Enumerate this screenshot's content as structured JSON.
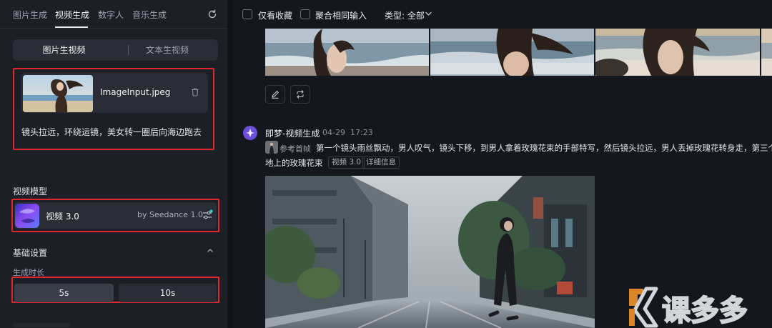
{
  "left": {
    "tabs": [
      "图片生成",
      "视频生成",
      "数字人",
      "音乐生成"
    ],
    "active_tab": "视频生成",
    "mode_tabs": [
      "图片生视频",
      "文本生视频"
    ],
    "active_mode": "图片生视频",
    "image_input": {
      "filename": "ImageInput.jpeg",
      "prompt": "镜头拉远，环绕运镜，美女转一圈后向海边跑去"
    },
    "model_section_title": "视频模型",
    "model": {
      "name": "视频 3.0",
      "provider": "by Seedance 1.0"
    },
    "basic_settings_title": "基础设置",
    "duration_title": "生成时长",
    "durations": [
      "5s",
      "10s"
    ],
    "selected_duration": "5s"
  },
  "right": {
    "filters": {
      "only_favorites": "仅看收藏",
      "aggregate_same_input": "聚合相同输入",
      "type_label": "类型: 全部"
    },
    "message": {
      "title": "即梦-视频生成",
      "date": "04-29",
      "time": "17:23",
      "ref_label": "参考首帧",
      "desc_line1": "第一个镜头雨丝飘动，男人叹气，镜头下移，到男人拿着玫瑰花束的手部特写，然后镜头拉远，男人丢掉玫瑰花转身走，第三个",
      "desc_line2": "地上的玫瑰花束",
      "tag_model": "视频 3.0",
      "tag_detail": "详细信息"
    }
  },
  "watermark_text": "课多多",
  "colors": {
    "panel": "#1d1f27",
    "background": "#15171e",
    "card": "#2a2d36",
    "highlight_border": "#e0262a",
    "accent": "#6b4fd8"
  }
}
